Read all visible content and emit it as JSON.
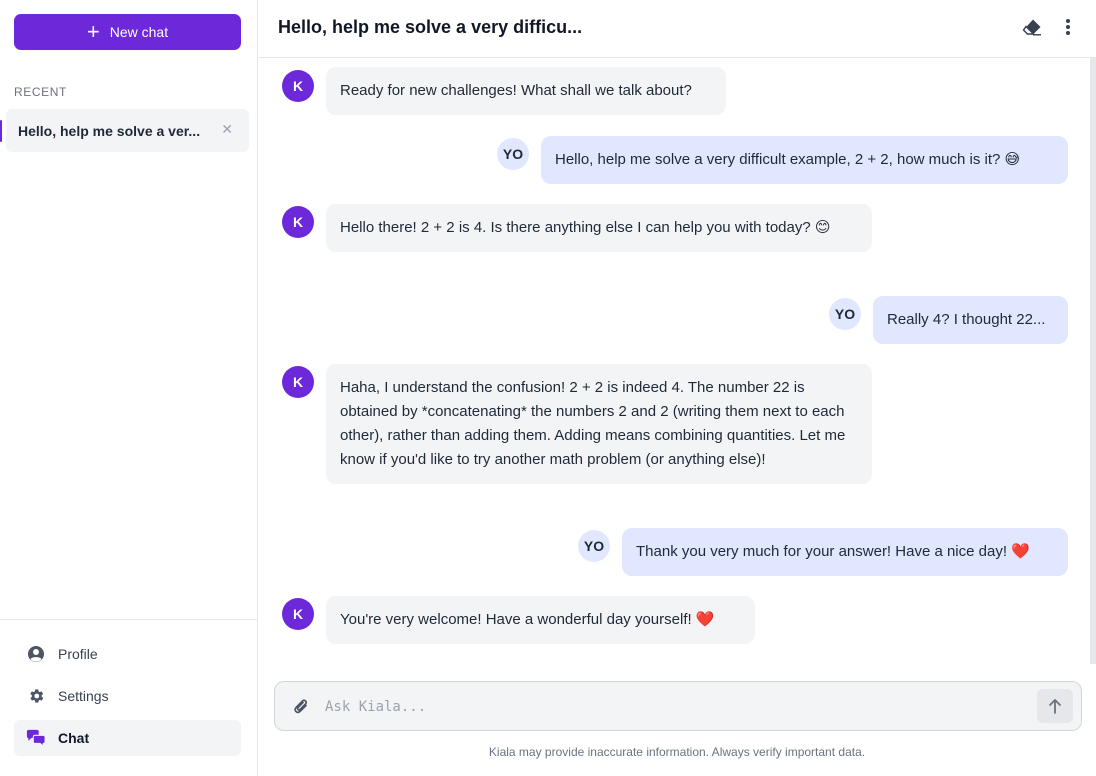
{
  "sidebar": {
    "new_chat_label": "New chat",
    "recent_label": "RECENT",
    "recent_items": [
      {
        "label": "Hello, help me solve a ver..."
      }
    ],
    "nav": {
      "profile": "Profile",
      "settings": "Settings",
      "chat": "Chat"
    }
  },
  "header": {
    "title": "Hello, help me solve a very difficu...",
    "icons": [
      "eraser-icon",
      "more-vertical-icon"
    ]
  },
  "messages": [
    {
      "role": "bot",
      "avatar": "K",
      "text": "Ready for new challenges! What shall we talk about?"
    },
    {
      "role": "user",
      "avatar": "YO",
      "text": "Hello, help me solve a very difficult example, 2 + 2, how much is it? 😅"
    },
    {
      "role": "bot",
      "avatar": "K",
      "text": "Hello there! 2 + 2 is 4. Is there anything else I can help you with today? 😊"
    },
    {
      "role": "user",
      "avatar": "YO",
      "text": "Really 4? I thought 22..."
    },
    {
      "role": "bot",
      "avatar": "K",
      "text": "Haha, I understand the confusion! 2 + 2 is indeed 4. The number 22 is obtained by *concatenating* the numbers 2 and 2 (writing them next to each other), rather than adding them. Adding means combining quantities. Let me know if you'd like to try another math problem (or anything else)!"
    },
    {
      "role": "user",
      "avatar": "YO",
      "text": "Thank you very much for your answer! Have a nice day! ❤️"
    },
    {
      "role": "bot",
      "avatar": "K",
      "text": "You're very welcome! Have a wonderful day yourself! ❤️"
    }
  ],
  "composer": {
    "placeholder": "Ask Kiala...",
    "value": "",
    "disclaimer": "Kiala may provide inaccurate information. Always verify important data."
  },
  "colors": {
    "accent": "#6d28d9",
    "user_bubble": "#e0e7ff",
    "bot_bubble": "#f3f4f6"
  }
}
